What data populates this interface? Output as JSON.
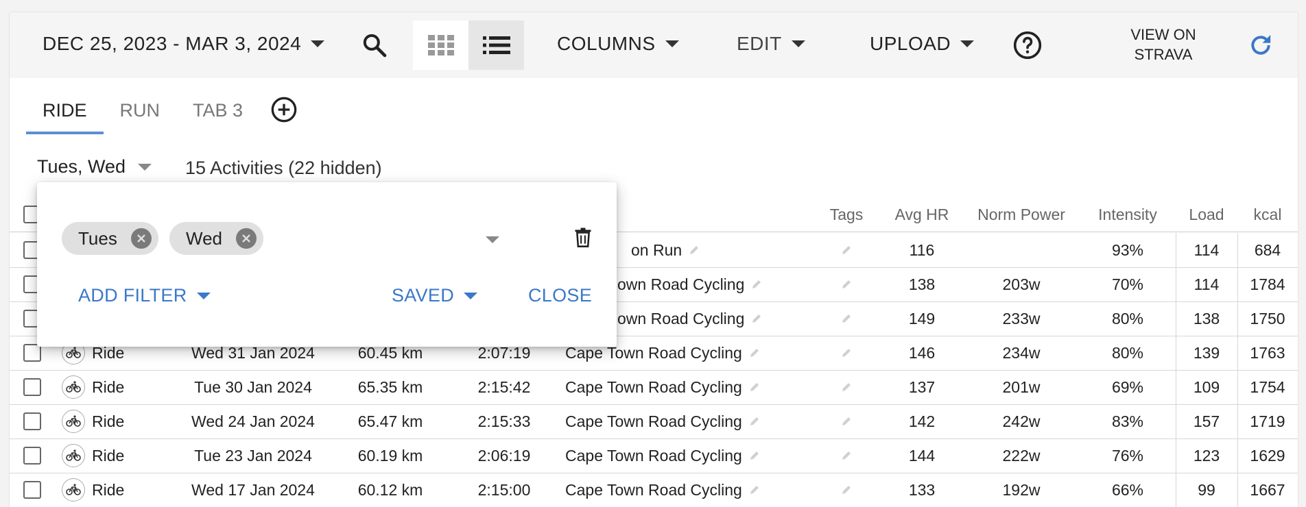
{
  "toolbar": {
    "date_range": "DEC 25, 2023 - MAR 3, 2024",
    "columns_label": "COLUMNS",
    "edit_label": "EDIT",
    "upload_label": "UPLOAD",
    "view_on_strava_line1": "VIEW ON",
    "view_on_strava_line2": "STRAVA",
    "icons": [
      "search-icon",
      "grid-view-icon",
      "list-view-icon",
      "help-icon",
      "refresh-icon"
    ]
  },
  "tabs": [
    {
      "label": "RIDE",
      "active": true
    },
    {
      "label": "RUN",
      "active": false
    },
    {
      "label": "TAB 3",
      "active": false
    }
  ],
  "filter_bar": {
    "day_filter": "Tues, Wed",
    "activity_count": "15 Activities (22 hidden)"
  },
  "popup": {
    "chips": [
      "Tues",
      "Wed"
    ],
    "add_filter": "ADD FILTER",
    "saved": "SAVED",
    "close": "CLOSE"
  },
  "table": {
    "headers": {
      "tags": "Tags",
      "avg_hr": "Avg HR",
      "norm_power": "Norm Power",
      "intensity": "Intensity",
      "load": "Load",
      "kcal": "kcal"
    },
    "partial_names": {
      "row0": "on Run",
      "row1": "own Road Cycling",
      "row2": "own Road Cycling"
    },
    "rows": [
      {
        "type": "",
        "date": "",
        "distance": "",
        "time": "",
        "name": "",
        "avg_hr": "116",
        "norm_power": "",
        "intensity": "93%",
        "load": "114",
        "kcal": "684"
      },
      {
        "type": "",
        "date": "",
        "distance": "",
        "time": "",
        "name": "",
        "avg_hr": "138",
        "norm_power": "203w",
        "intensity": "70%",
        "load": "114",
        "kcal": "1784"
      },
      {
        "type": "",
        "date": "",
        "distance": "",
        "time": "",
        "name": "",
        "avg_hr": "149",
        "norm_power": "233w",
        "intensity": "80%",
        "load": "138",
        "kcal": "1750"
      },
      {
        "type": "Ride",
        "date": "Wed 31 Jan 2024",
        "distance": "60.45 km",
        "time": "2:07:19",
        "name": "Cape Town Road Cycling",
        "avg_hr": "146",
        "norm_power": "234w",
        "intensity": "80%",
        "load": "139",
        "kcal": "1763"
      },
      {
        "type": "Ride",
        "date": "Tue 30 Jan 2024",
        "distance": "65.35 km",
        "time": "2:15:42",
        "name": "Cape Town Road Cycling",
        "avg_hr": "137",
        "norm_power": "201w",
        "intensity": "69%",
        "load": "109",
        "kcal": "1754"
      },
      {
        "type": "Ride",
        "date": "Wed 24 Jan 2024",
        "distance": "65.47 km",
        "time": "2:15:33",
        "name": "Cape Town Road Cycling",
        "avg_hr": "142",
        "norm_power": "242w",
        "intensity": "83%",
        "load": "157",
        "kcal": "1719"
      },
      {
        "type": "Ride",
        "date": "Tue 23 Jan 2024",
        "distance": "60.19 km",
        "time": "2:06:19",
        "name": "Cape Town Road Cycling",
        "avg_hr": "144",
        "norm_power": "222w",
        "intensity": "76%",
        "load": "123",
        "kcal": "1629"
      },
      {
        "type": "Ride",
        "date": "Wed 17 Jan 2024",
        "distance": "60.12 km",
        "time": "2:15:00",
        "name": "Cape Town Road Cycling",
        "avg_hr": "133",
        "norm_power": "192w",
        "intensity": "66%",
        "load": "99",
        "kcal": "1667"
      }
    ]
  },
  "colors": {
    "accent": "#3a78c8",
    "tab_underline": "#5b8fd6",
    "toolbar_bg": "#f5f5f5",
    "refresh_icon": "#3a78c8"
  }
}
